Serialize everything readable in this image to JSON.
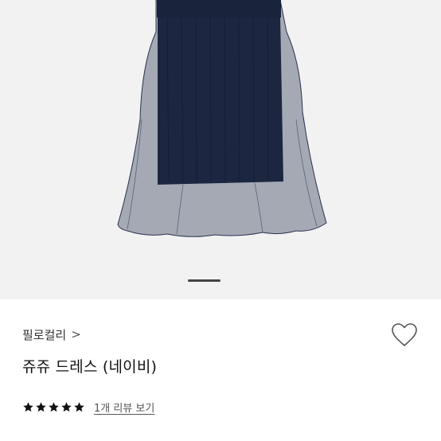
{
  "product": {
    "brand": "필로컬리",
    "brand_chevron": ">",
    "name": "쥬쥬 드레스 (네이비)",
    "image_subject": "navy tulle skirt",
    "color_accent": "#1c2640",
    "carousel": {
      "current_slide": 1
    },
    "rating": {
      "stars": 5,
      "max_stars": 5,
      "star_color": "#111111"
    },
    "review_link": "1개 리뷰 보기",
    "wishlist_icon": "heart-outline-icon"
  }
}
